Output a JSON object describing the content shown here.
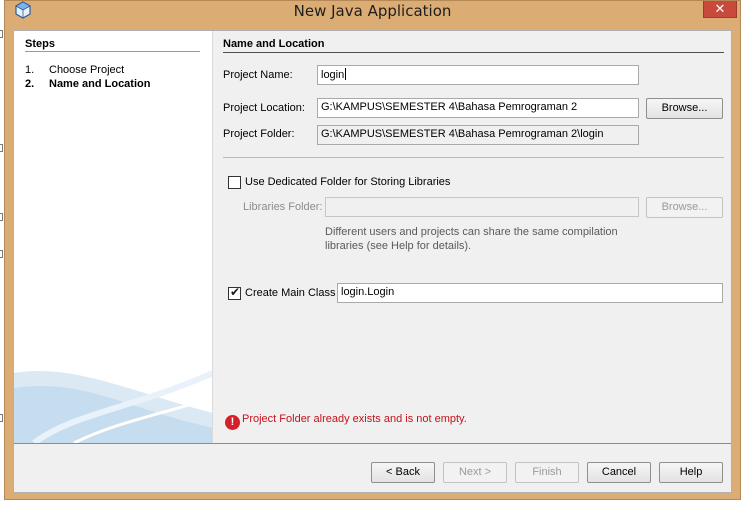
{
  "window": {
    "title": "New Java Application",
    "close_glyph": "✕",
    "icon": "netbeans-cube-icon"
  },
  "steps": {
    "title": "Steps",
    "items": [
      {
        "number": "1.",
        "label": "Choose Project"
      },
      {
        "number": "2.",
        "label": "Name and Location"
      }
    ],
    "active_index": 1
  },
  "panel": {
    "title": "Name and Location",
    "project_name_label": "Project Name:",
    "project_name_value": "login",
    "project_location_label": "Project Location:",
    "project_location_value": "G:\\KAMPUS\\SEMESTER  4\\Bahasa Pemrograman 2",
    "project_folder_label": "Project Folder:",
    "project_folder_value": "G:\\KAMPUS\\SEMESTER  4\\Bahasa Pemrograman 2\\login",
    "browse_label": "Browse...",
    "dedicated_folder_label": "Use Dedicated Folder for Storing Libraries",
    "dedicated_folder_checked": false,
    "libraries_folder_label": "Libraries Folder:",
    "libraries_folder_value": "",
    "libraries_browse_label": "Browse...",
    "libraries_hint": "Different users and projects can share the same compilation libraries (see Help for details).",
    "create_main_class_label": "Create Main Class",
    "create_main_class_checked": true,
    "main_class_value": "login.Login",
    "check_glyph": "✔"
  },
  "error": {
    "icon_glyph": "!",
    "message": "Project Folder already exists and is not empty."
  },
  "footer": {
    "back_label": "< Back",
    "next_label": "Next >",
    "finish_label": "Finish",
    "cancel_label": "Cancel",
    "help_label": "Help"
  },
  "colors": {
    "frame": "#dcac75",
    "close_button": "#c74a3d",
    "error_text": "#c3131b"
  }
}
